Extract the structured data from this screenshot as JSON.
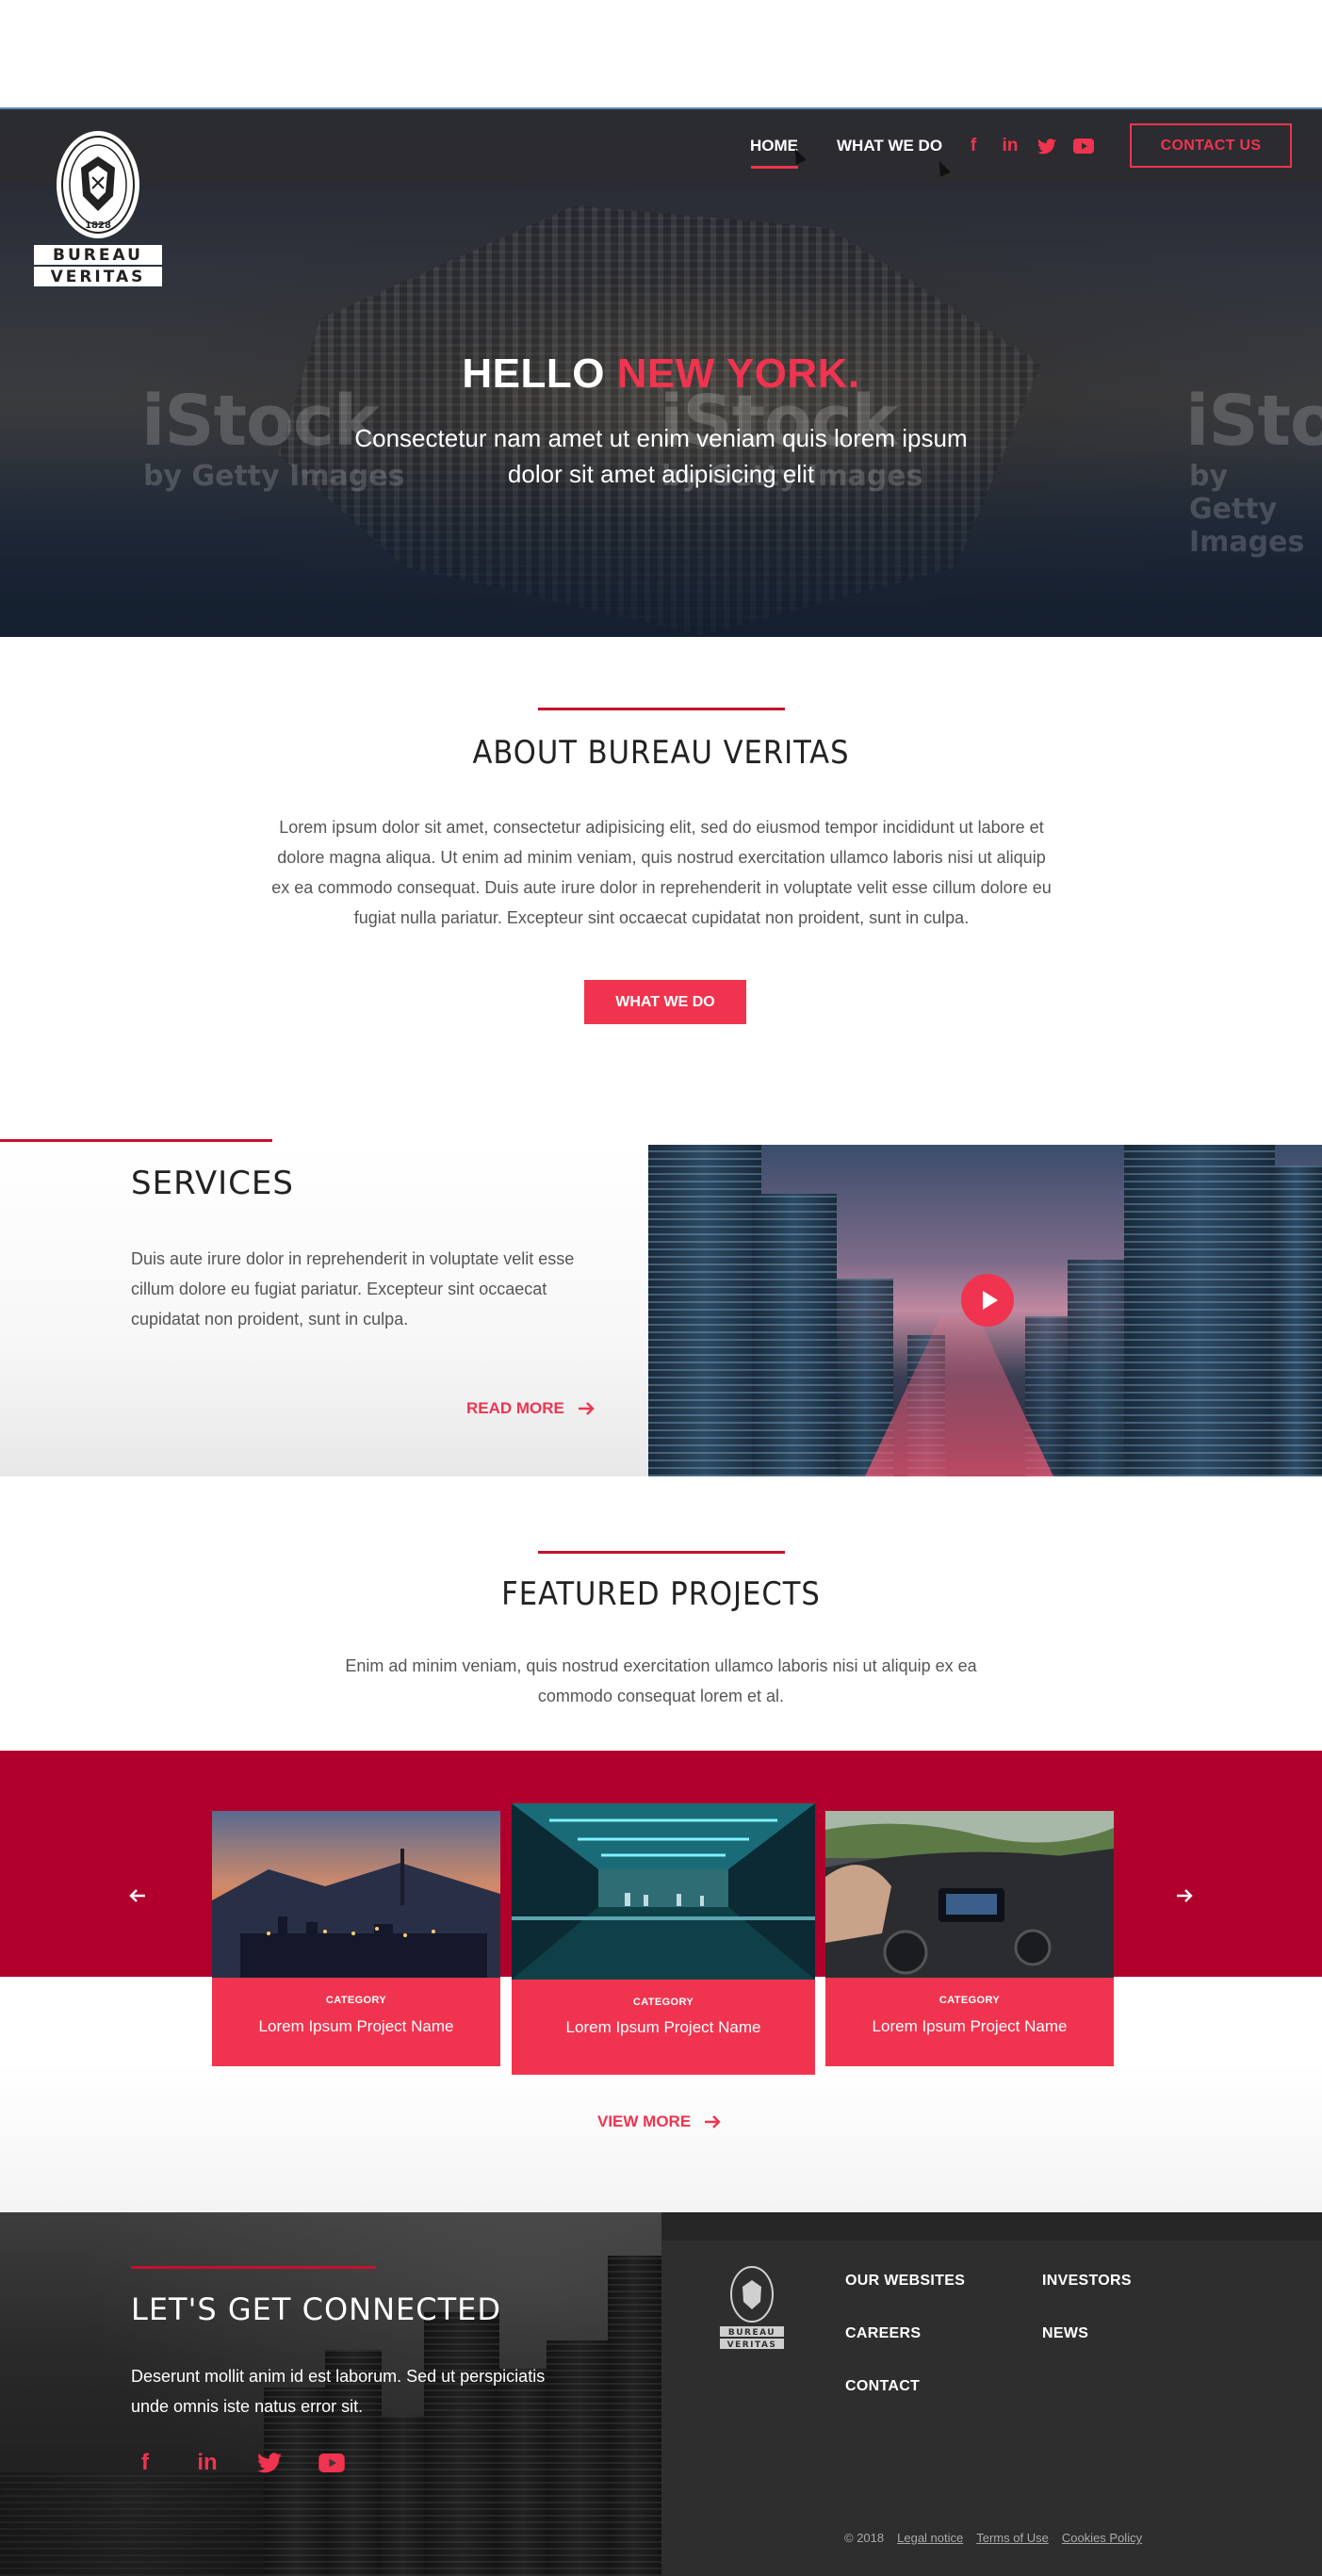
{
  "brand": {
    "name_line1": "BUREAU",
    "name_line2": "VERITAS",
    "year": "1828",
    "ring_text": "BUREAU VERITAS"
  },
  "colors": {
    "accent": "#f0344f",
    "accent_dark": "#b0002b",
    "dark": "#2e2e2e"
  },
  "nav": {
    "home": "HOME",
    "what_we_do": "WHAT WE DO",
    "contact": "CONTACT US",
    "social_icons": [
      "facebook-icon",
      "linkedin-icon",
      "twitter-icon",
      "youtube-icon"
    ]
  },
  "hero": {
    "title_white": "HELLO ",
    "title_accent": "NEW YORK.",
    "subtitle": "Consectetur nam amet ut enim veniam quis lorem ipsum dolor sit amet adipisicing elit",
    "watermark_big": "iStock",
    "watermark_small": "by Getty Images"
  },
  "about": {
    "title": "ABOUT BUREAU VERITAS",
    "text": "Lorem ipsum dolor sit amet, consectetur adipisicing elit, sed do eiusmod tempor incididunt ut labore et dolore magna aliqua. Ut enim ad minim veniam, quis nostrud exercitation ullamco laboris nisi ut aliquip ex ea commodo consequat. Duis aute irure dolor in reprehenderit in voluptate velit esse cillum dolore eu fugiat nulla pariatur. Excepteur sint occaecat cupidatat non proident, sunt in culpa.",
    "button": "WHAT WE DO"
  },
  "services": {
    "title": "SERVICES",
    "text": "Duis aute irure dolor in reprehenderit in voluptate velit esse cillum dolore eu fugiat pariatur. Excepteur sint occaecat cupidatat non proident, sunt in culpa.",
    "link": "READ MORE"
  },
  "featured": {
    "title": "FEATURED PROJECTS",
    "text": "Enim ad minim veniam, quis nostrud exercitation ullamco laboris nisi ut aliquip ex ea commodo consequat lorem et al.",
    "cards": [
      {
        "category": "CATEGORY",
        "name": "Lorem Ipsum Project Name"
      },
      {
        "category": "CATEGORY",
        "name": "Lorem Ipsum Project Name"
      },
      {
        "category": "CATEGORY",
        "name": "Lorem Ipsum Project Name"
      }
    ],
    "view_more": "VIEW MORE"
  },
  "footer": {
    "title": "LET'S GET CONNECTED",
    "text": "Deserunt mollit anim id est laborum. Sed ut perspiciatis unde omnis iste natus error sit.",
    "links": {
      "our_websites": "OUR WEBSITES",
      "investors": "INVESTORS",
      "careers": "CAREERS",
      "news": "NEWS",
      "contact": "CONTACT"
    },
    "copyright": "© 2018",
    "legal_notice": "Legal notice",
    "terms": "Terms of Use",
    "cookies": "Cookies Policy"
  }
}
